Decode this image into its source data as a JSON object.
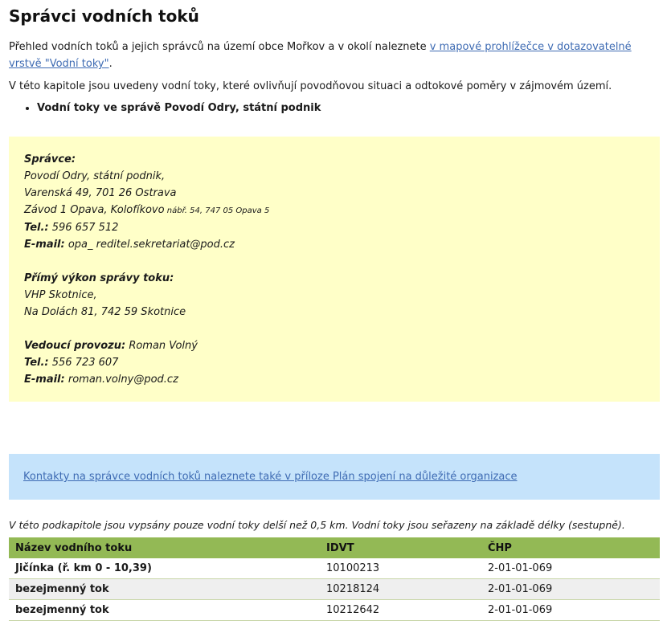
{
  "title": "Správci vodních toků",
  "intro": {
    "text_before": "Přehled vodních toků a jejich správců na území obce Mořkov a v okolí naleznete ",
    "link_text": "v mapové prohlížečce v dotazovatelné vrstvě \"Vodní toky\"",
    "text_after": "."
  },
  "intro2": "V této kapitole jsou uvedeny vodní toky, které ovlivňují povodňovou situaci a odtokové poměry v zájmovém území.",
  "bullets": [
    "Vodní toky ve správě Povodí Odry, státní podnik"
  ],
  "manager": {
    "label": "Správce:",
    "line1": "Povodí Odry, státní podnik,",
    "line2": "Varenská 49, 701 26 Ostrava",
    "line3_main": "Závod 1 Opava, Kolofíkovo",
    "line3_small": " nábř. 54, 747 05 Opava 5",
    "tel_label": "Tel.:",
    "tel": " 596 657 512",
    "email_label": "E-mail:",
    "email": " opa_ reditel.sekretariat@pod.cz"
  },
  "direct": {
    "label": "Přímý výkon správy toku:",
    "line1": "VHP Skotnice,",
    "line2": "Na Dolách 81, 742 59 Skotnice"
  },
  "head": {
    "label": "Vedoucí provozu:",
    "name": " Roman Volný",
    "tel_label": "Tel.:",
    "tel": " 556 723 607",
    "email_label": "E-mail:",
    "email": " roman.volny@pod.cz"
  },
  "contacts_link": "Kontakty na správce vodních toků naleznete také v příloze Plán spojení na důležité organizace",
  "note": "V této podkapitole jsou vypsány pouze vodní toky delší než 0,5 km. Vodní toky jsou seřazeny na základě délky (sestupně).",
  "table": {
    "headers": [
      "Název vodního toku",
      "IDVT",
      "ČHP"
    ],
    "rows": [
      [
        "Jičínka (ř. km 0 - 10,39)",
        "10100213",
        "2-01-01-069"
      ],
      [
        "bezejmenný tok",
        "10218124",
        "2-01-01-069"
      ],
      [
        "bezejmenný tok",
        "10212642",
        "2-01-01-069"
      ]
    ]
  },
  "colors": {
    "yellow_box": "#ffffc8",
    "blue_box": "#c5e3fb",
    "table_header": "#93b955",
    "link": "#3e6bb3"
  }
}
